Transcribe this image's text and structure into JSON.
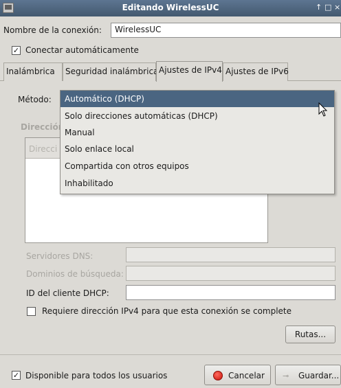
{
  "window": {
    "title": "Editando WirelessUC",
    "controls": [
      "↑",
      "□",
      "×"
    ]
  },
  "connection_name": {
    "label": "Nombre de la conexión:",
    "value": "WirelessUC"
  },
  "auto_connect": {
    "label": "Conectar automáticamente",
    "checked": true
  },
  "tabs": [
    {
      "label": "Inalámbrica"
    },
    {
      "label": "Seguridad inalámbrica"
    },
    {
      "label": "Ajustes de IPv4"
    },
    {
      "label": "Ajustes de IPv6"
    }
  ],
  "ipv4": {
    "method_label": "Método:",
    "addresses_label": "Dirección",
    "addresses_col": "Direcci",
    "dns_label": "Servidores DNS:",
    "search_domains_label": "Dominios de búsqueda:",
    "dhcp_client_id_label": "ID del cliente DHCP:",
    "dhcp_client_id_value": "",
    "require_ipv4_label": "Requiere dirección IPv4 para que esta conexión se complete",
    "require_ipv4_checked": false,
    "routes_button": "Rutas..."
  },
  "method_dropdown": {
    "selected": "Automático (DHCP)",
    "options": [
      "Automático (DHCP)",
      "Solo direcciones automáticas (DHCP)",
      "Manual",
      "Solo enlace local",
      "Compartida con otros equipos",
      "Inhabilitado"
    ]
  },
  "footer": {
    "all_users_label": "Disponible para todos los usuarios",
    "all_users_checked": true,
    "cancel_button": "Cancelar",
    "save_button": "Guardar..."
  }
}
